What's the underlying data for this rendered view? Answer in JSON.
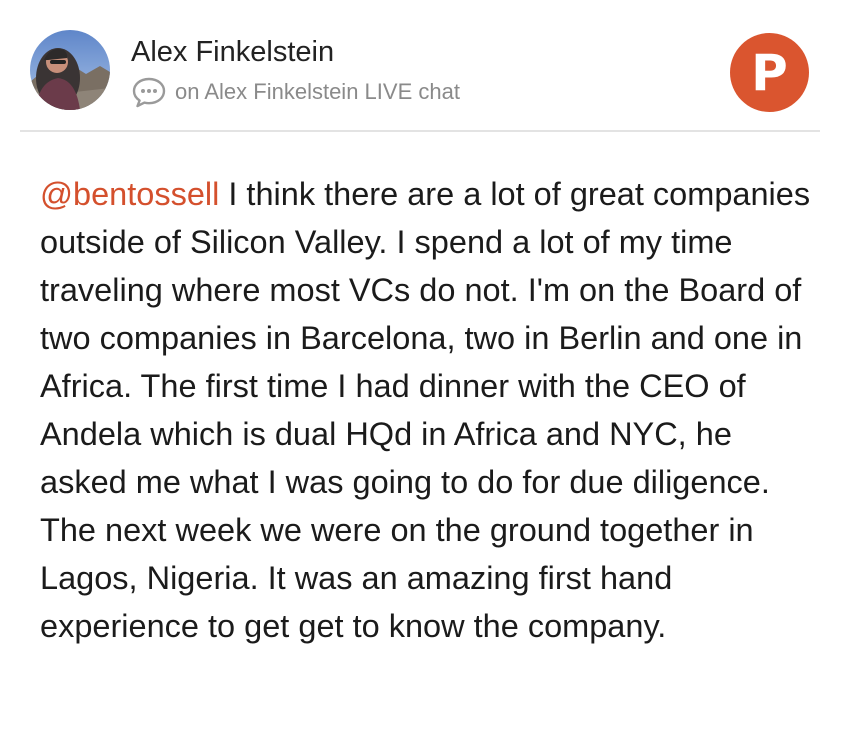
{
  "post": {
    "author_name": "Alex Finkelstein",
    "source_text": "on Alex Finkelstein LIVE chat",
    "mention": "@bentossell",
    "body": " I think there are a lot of great companies outside of Silicon Valley. I spend a lot of my time traveling where most VCs do not. I'm on the Board of two companies in Barcelona, two in Berlin and one in Africa. The first time I had dinner with the CEO of Andela which is dual HQd in Africa and NYC, he asked me what I was going to do for due diligence. The next week we were on the ground together in Lagos, Nigeria. It was an amazing first hand experience to get get to know the company."
  },
  "brand": {
    "letter": "P",
    "icon": "product-hunt-logo",
    "color": "#da552f"
  },
  "icons": {
    "avatar": "author-avatar-photo",
    "source": "chat-bubble-icon"
  },
  "colors": {
    "mention": "#d4502d",
    "secondary_text": "#8a8a8a",
    "divider": "#e3e3e3"
  }
}
